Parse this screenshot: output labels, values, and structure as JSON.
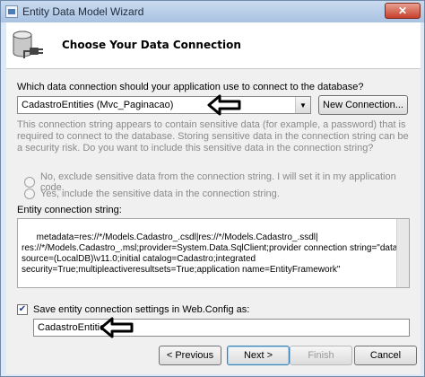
{
  "window": {
    "title": "Entity Data Model Wizard",
    "close_glyph": "✕"
  },
  "header": {
    "title": "Choose Your Data Connection",
    "icon": "database-connection-icon"
  },
  "connection": {
    "question": "Which data connection should your application use to connect to the database?",
    "selected": "CadastroEntities (Mvc_Paginacao)",
    "new_connection_label": "New Connection..."
  },
  "sensitive": {
    "notice": "This connection string appears to contain sensitive data (for example, a password) that is required to connect to the database. Storing sensitive data in the connection string can be a security risk. Do you want to include this sensitive data in the connection string?",
    "option_no": "No, exclude sensitive data from the connection string. I will set it in my application code.",
    "option_yes": "Yes, include the sensitive data in the connection string."
  },
  "entity_connection": {
    "label": "Entity connection string:",
    "value": "metadata=res://*/Models.Cadastro_.csdl|res://*/Models.Cadastro_.ssdl|\nres://*/Models.Cadastro_.msl;provider=System.Data.SqlClient;provider connection string=\"data\nsource=(LocalDB)\\v11.0;initial catalog=Cadastro;integrated\nsecurity=True;multipleactiveresultsets=True;application name=EntityFramework\""
  },
  "save": {
    "checked": true,
    "label": "Save entity connection settings in Web.Config as:",
    "name_value": "CadastroEntities"
  },
  "buttons": {
    "previous": "< Previous",
    "next": "Next >",
    "finish": "Finish",
    "cancel": "Cancel"
  }
}
